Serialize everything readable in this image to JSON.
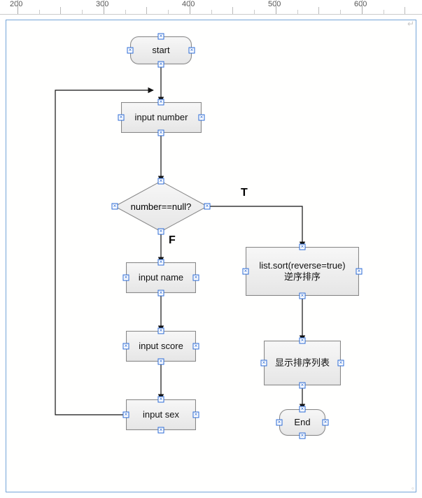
{
  "ruler": {
    "labels": [
      "200",
      "300",
      "400",
      "500",
      "600"
    ]
  },
  "nodes": {
    "start": {
      "label": "start"
    },
    "inputNumber": {
      "label": "input number"
    },
    "decision": {
      "label": "number==null?"
    },
    "branchT": {
      "label": "T"
    },
    "branchF": {
      "label": "F"
    },
    "inputName": {
      "label": "input name"
    },
    "inputScore": {
      "label": "input score"
    },
    "inputSex": {
      "label": "input sex"
    },
    "sort": {
      "line1": "list.sort(reverse=true)",
      "line2": "逆序排序"
    },
    "display": {
      "label": "显示排序列表"
    },
    "end": {
      "label": "End"
    }
  }
}
